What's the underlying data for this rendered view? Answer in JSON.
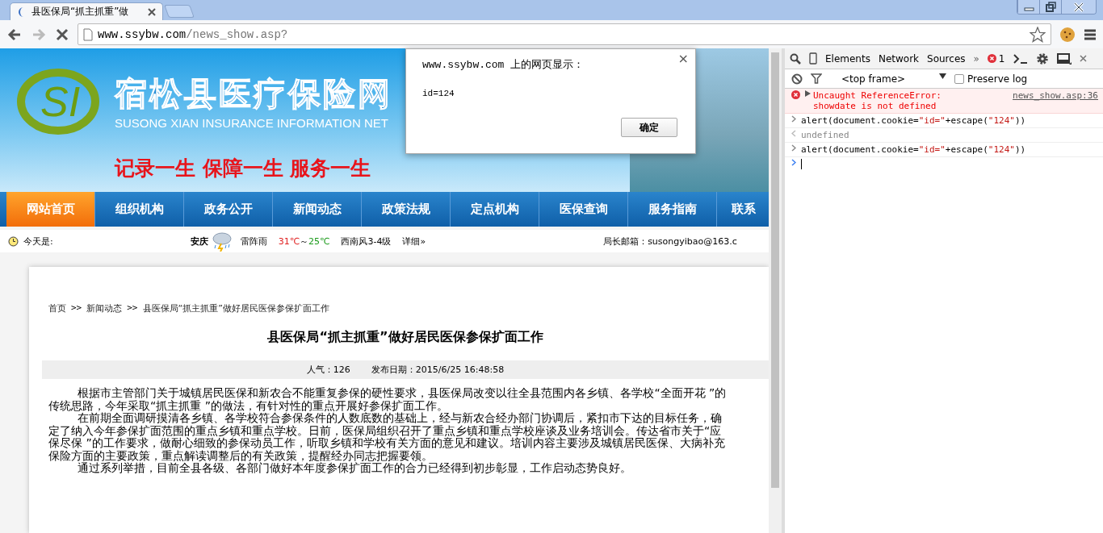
{
  "browser": {
    "tabs": [
      {
        "title": "县医保局“抓主抓重”做",
        "selected": true
      }
    ],
    "address": {
      "host": "www.ssybw.com",
      "path": "/news_show.asp?"
    }
  },
  "site": {
    "title": "宿松县医疗保险网",
    "subtitle": "SUSONG XIAN INSURANCE INFORMATION NET",
    "slogan": "记录一生 保障一生 服务一生",
    "logo": "SI",
    "nav": [
      {
        "label": "网站首页",
        "selected": true
      },
      {
        "label": "组织机构",
        "selected": false
      },
      {
        "label": "政务公开",
        "selected": false
      },
      {
        "label": "新闻动态",
        "selected": false
      },
      {
        "label": "政策法规",
        "selected": false
      },
      {
        "label": "定点机构",
        "selected": false
      },
      {
        "label": "医保查询",
        "selected": false
      },
      {
        "label": "服务指南",
        "selected": false
      },
      {
        "label": "联系",
        "selected": false
      }
    ],
    "weather": {
      "today": "今天是:",
      "city": "安庆",
      "condition": "雷阵雨",
      "high": "31℃",
      "range_sep": "～",
      "low": "25℃",
      "wind": "西南风3-4级",
      "details": "详细»",
      "mailbox": "局长邮箱：susongyibao@163.c"
    },
    "breadcrumb": [
      {
        "kind": "link",
        "text": "首页"
      },
      {
        "kind": "sep",
        "text": ">>"
      },
      {
        "kind": "link",
        "text": "新闻动态"
      },
      {
        "kind": "sep",
        "text": ">>"
      },
      {
        "kind": "link",
        "text": "县医保局“抓主抓重”做好居民医保参保扩面工作"
      }
    ],
    "article": {
      "title": "县医保局“抓主抓重”做好居民医保参保扩面工作",
      "views": "人气：126",
      "date": "发布日期：2015/6/25 16:48:58",
      "paragraphs": [
        "根据市主管部门关于城镇居民医保和新农合不能重复参保的硬性要求，县医保局改变以往全县范围内各乡镇、各学校“全面开花 ”的传统思路，今年采取“抓主抓重 ”的做法，有针对性的重点开展好参保扩面工作。",
        "在前期全面调研摸清各乡镇、各学校符合参保条件的人数底数的基础上，经与新农合经办部门协调后，紧扣市下达的目标任务，确定了纳入今年参保扩面范围的重点乡镇和重点学校。日前，医保局组织召开了重点乡镇和重点学校座谈及业务培训会。传达省市关于“应保尽保 ”的工作要求，做耐心细致的参保动员工作，听取乡镇和学校有关方面的意见和建议。培训内容主要涉及城镇居民医保、大病补充保险方面的主要政策，重点解读调整后的有关政策，提醒经办同志把握要领。",
        "通过系列举措，目前全县各级、各部门做好本年度参保扩面工作的合力已经得到初步彰显，工作启动态势良好。"
      ]
    }
  },
  "dialog": {
    "title": "www.ssybw.com 上的网页显示：",
    "message": "id=124",
    "close": "×",
    "button": "确定"
  },
  "devtools": {
    "tabs": [
      "Elements",
      "Network",
      "Sources"
    ],
    "more": "»",
    "error_count": "1",
    "frame": "<top frame>",
    "preserve_log": {
      "label": "Preserve log",
      "checked": false
    },
    "messages": [
      {
        "kind": "error",
        "lines": [
          "Uncaught ReferenceError:",
          "showdate is not defined"
        ],
        "source": "news_show.asp:36"
      },
      {
        "kind": "input",
        "parts": [
          {
            "kind": "plain",
            "text": "alert(document.cookie="
          },
          {
            "kind": "string",
            "text": "\"id=\""
          },
          {
            "kind": "plain",
            "text": "+escape("
          },
          {
            "kind": "string",
            "text": "\"124\""
          },
          {
            "kind": "plain",
            "text": "))"
          }
        ]
      },
      {
        "kind": "output",
        "text": "undefined"
      },
      {
        "kind": "input",
        "parts": [
          {
            "kind": "plain",
            "text": "alert(document.cookie="
          },
          {
            "kind": "string",
            "text": "\"id=\""
          },
          {
            "kind": "plain",
            "text": "+escape("
          },
          {
            "kind": "string",
            "text": "\"124\""
          },
          {
            "kind": "plain",
            "text": "))"
          }
        ]
      },
      {
        "kind": "prompt"
      }
    ]
  }
}
